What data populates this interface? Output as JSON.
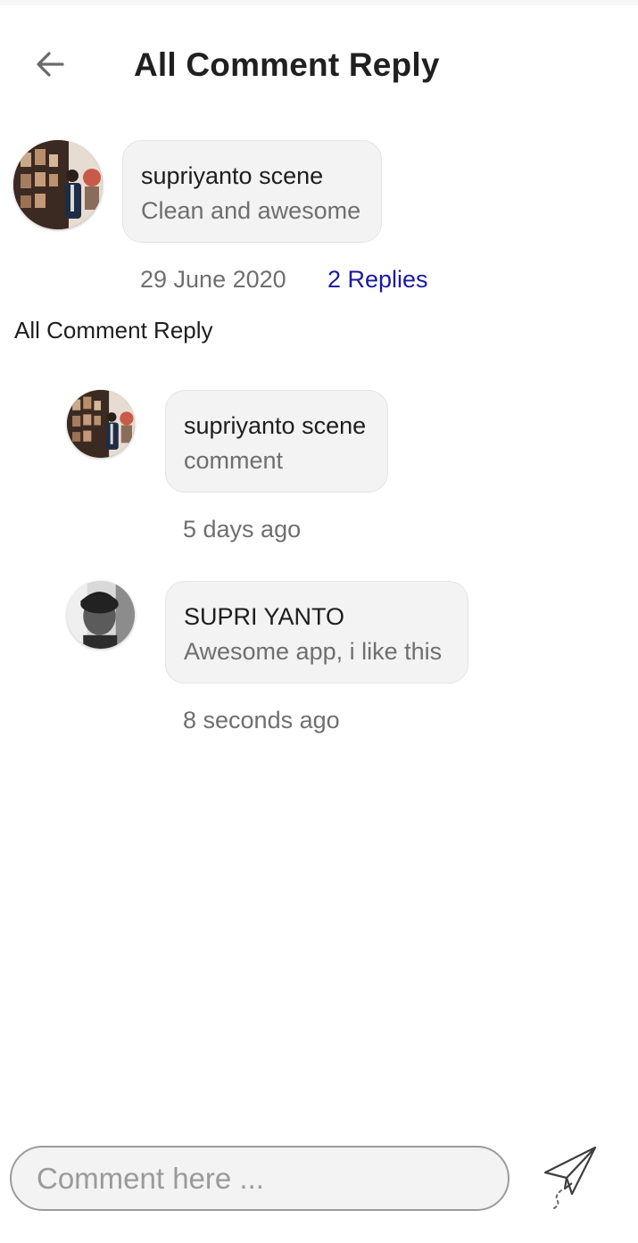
{
  "header": {
    "title": "All Comment Reply",
    "back_icon": "arrow-left-icon"
  },
  "main_comment": {
    "author": "supriyanto scene",
    "text": "Clean and awesome",
    "date": "29 June 2020",
    "replies_label": "2 Replies",
    "replies_color": "#1a1aa0"
  },
  "section_label": "All Comment Reply",
  "replies": [
    {
      "author": "supriyanto scene",
      "text": "comment",
      "time": "5 days ago"
    },
    {
      "author": "SUPRI YANTO",
      "text": "Awesome app, i like this",
      "time": "8 seconds ago"
    }
  ],
  "composer": {
    "placeholder": "Comment here ...",
    "send_icon": "paper-plane-icon"
  }
}
